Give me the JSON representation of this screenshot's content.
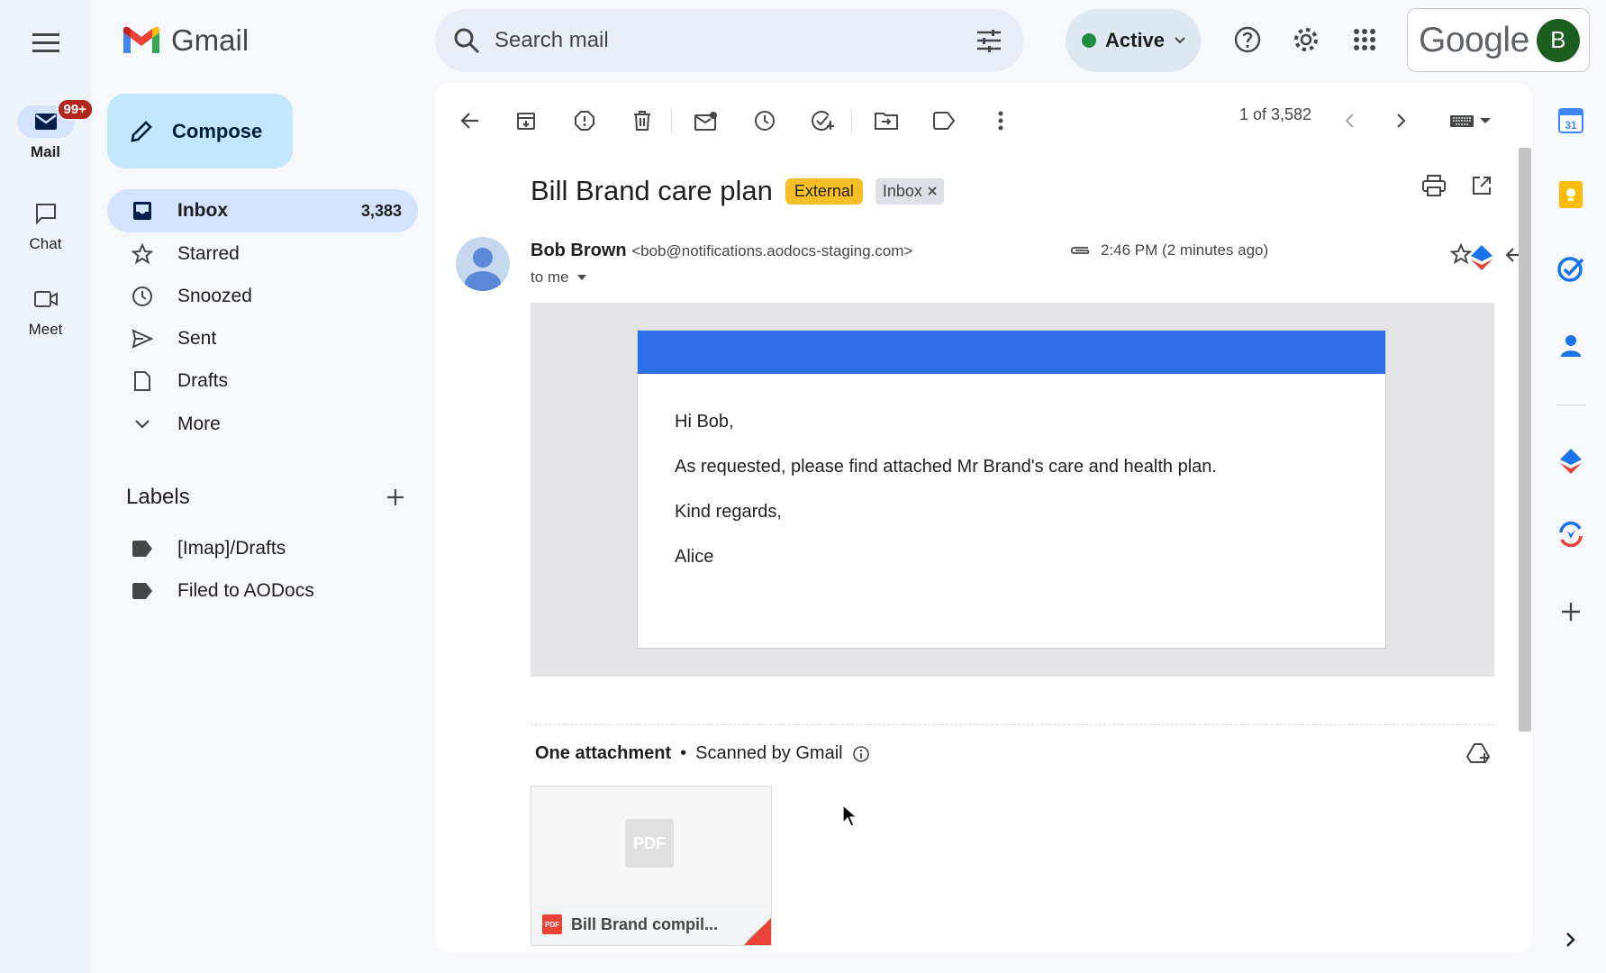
{
  "app": {
    "name": "Gmail",
    "brand": "Google",
    "account_initial": "B"
  },
  "rail": {
    "mail_label": "Mail",
    "mail_badge": "99+",
    "chat_label": "Chat",
    "meet_label": "Meet"
  },
  "search": {
    "placeholder": "Search mail"
  },
  "status": {
    "label": "Active"
  },
  "compose": {
    "label": "Compose"
  },
  "nav": {
    "inbox": "Inbox",
    "inbox_count": "3,383",
    "starred": "Starred",
    "snoozed": "Snoozed",
    "sent": "Sent",
    "drafts": "Drafts",
    "more": "More"
  },
  "labels": {
    "title": "Labels",
    "items": [
      "[Imap]/Drafts",
      "Filed to AODocs"
    ]
  },
  "toolbar": {
    "pager": "1 of 3,582"
  },
  "email": {
    "subject": "Bill Brand care plan",
    "tag_external": "External",
    "tag_inbox": "Inbox",
    "sender_name": "Bob Brown",
    "sender_email": "<bob@notifications.aodocs-staging.com>",
    "to": "to me",
    "time": "2:46 PM (2 minutes ago)",
    "body": {
      "greeting": "Hi Bob,",
      "line1": "As requested, please find attached Mr Brand's care and health plan.",
      "closing": "Kind regards,",
      "signature": "Alice"
    }
  },
  "attachments": {
    "header": "One attachment",
    "scanned": "Scanned by Gmail",
    "file_name": "Bill Brand compil...",
    "file_type": "PDF"
  },
  "colors": {
    "brand_blue": "#2f6fe8",
    "external_tag": "#f6bf26",
    "active_dot": "#1e8e3e",
    "badge_red": "#b3261e"
  }
}
